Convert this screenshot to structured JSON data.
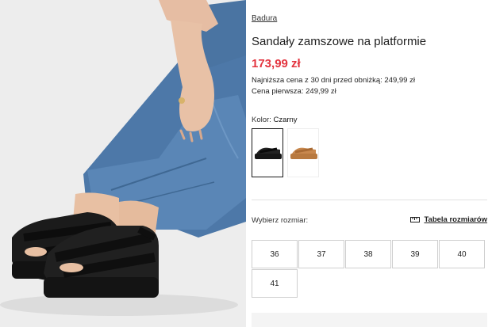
{
  "product": {
    "brand": "Badura",
    "title": "Sandały zamszowe na platformie",
    "price": "173,99 zł",
    "lowest_price_label": "Najniższa cena z 30 dni przed obniżką:",
    "lowest_price_value": "249,99 zł",
    "first_price_label": "Cena pierwsza:",
    "first_price_value": "249,99 zł"
  },
  "color": {
    "label": "Kolor:",
    "selected": "Czarny",
    "swatches": [
      {
        "name": "black",
        "hex": "#161616",
        "selected": true
      },
      {
        "name": "tan",
        "hex": "#c8884e",
        "selected": false
      }
    ]
  },
  "size": {
    "label": "Wybierz rozmiar:",
    "table_link": "Tabela rozmiarów",
    "table_icon": "ruler-icon",
    "options": [
      "36",
      "37",
      "38",
      "39",
      "40",
      "41"
    ]
  },
  "colors": {
    "price": "#e3343f",
    "background": "#ffffff",
    "photo_background": "#ededed"
  }
}
